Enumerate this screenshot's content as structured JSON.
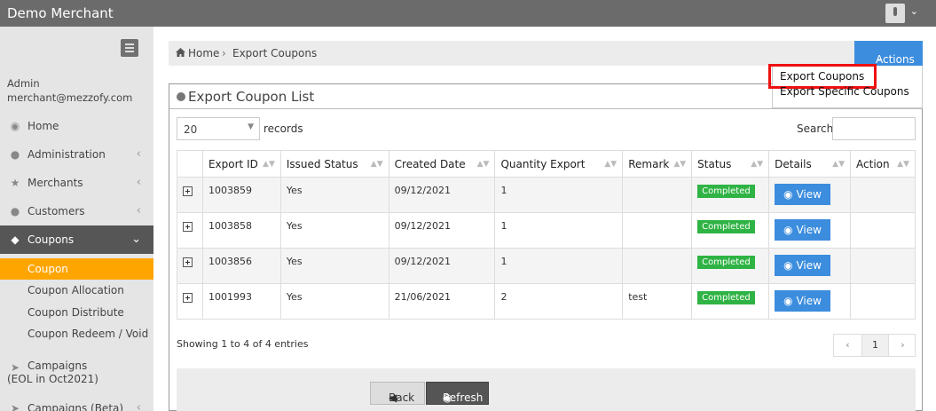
{
  "app": {
    "title": "Demo Merchant"
  },
  "user": {
    "role": "Admin",
    "email": "merchant@mezzofy.com"
  },
  "sidebar": {
    "items": [
      {
        "label": "Home",
        "icon": "dashboard-icon"
      },
      {
        "label": "Administration",
        "icon": "user-icon"
      },
      {
        "label": "Merchants",
        "icon": "star-icon"
      },
      {
        "label": "Customers",
        "icon": "users-icon"
      },
      {
        "label": "Coupons",
        "icon": "tag-icon"
      }
    ],
    "sub_items": [
      "Coupon",
      "Coupon Allocation",
      "Coupon Distribute",
      "Coupon Redeem / Void"
    ],
    "campaigns": {
      "line1": "Campaigns",
      "line2": "(EOL in Oct2021)"
    },
    "campaigns_beta": "Campaigns (Beta)"
  },
  "breadcrumb": {
    "home": "Home",
    "current": "Export Coupons"
  },
  "actions": {
    "label": "Actions",
    "menu": [
      "Export Coupons",
      "Export Specific Coupons"
    ]
  },
  "panel": {
    "title": "Export Coupon List"
  },
  "table_controls": {
    "page_length": "20",
    "records_label": "records",
    "search_label": "Search:"
  },
  "table": {
    "headers": [
      "Export ID",
      "Issued Status",
      "Created Date",
      "Quantity Export",
      "Remark",
      "Status",
      "Details",
      "Action"
    ],
    "rows": [
      {
        "id": "1003859",
        "issued": "Yes",
        "date": "09/12/2021",
        "qty": "1",
        "remark": "",
        "status": "Completed",
        "details": "View"
      },
      {
        "id": "1003858",
        "issued": "Yes",
        "date": "09/12/2021",
        "qty": "1",
        "remark": "",
        "status": "Completed",
        "details": "View"
      },
      {
        "id": "1003856",
        "issued": "Yes",
        "date": "09/12/2021",
        "qty": "1",
        "remark": "",
        "status": "Completed",
        "details": "View"
      },
      {
        "id": "1001993",
        "issued": "Yes",
        "date": "21/06/2021",
        "qty": "2",
        "remark": "test",
        "status": "Completed",
        "details": "View"
      }
    ]
  },
  "pagination": {
    "info": "Showing 1 to 4 of 4 entries",
    "prev": "‹",
    "page": "1",
    "next": "›"
  },
  "footer": {
    "back": "Back",
    "refresh": "Refresh"
  },
  "colors": {
    "accent": "#3c8dde",
    "active_sub": "#ffa500",
    "status_ok": "#2fb344",
    "highlight": "#e11111"
  }
}
